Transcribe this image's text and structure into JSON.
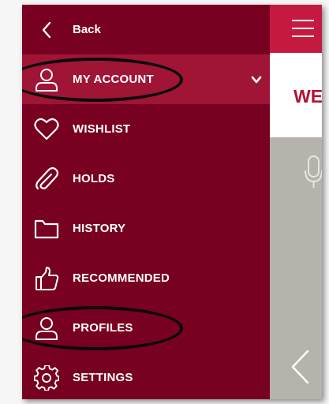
{
  "drawer": {
    "back_label": "Back",
    "items": [
      {
        "label": "MY ACCOUNT",
        "icon": "user-icon",
        "active": true,
        "expandable": true
      },
      {
        "label": "WISHLIST",
        "icon": "heart-icon"
      },
      {
        "label": "HOLDS",
        "icon": "paperclip-icon"
      },
      {
        "label": "HISTORY",
        "icon": "folder-icon"
      },
      {
        "label": "RECOMMENDED",
        "icon": "thumbs-up-icon"
      },
      {
        "label": "PROFILES",
        "icon": "user-icon"
      },
      {
        "label": "SETTINGS",
        "icon": "gear-icon"
      }
    ]
  },
  "main": {
    "welcome_text": "WE"
  },
  "colors": {
    "drawer_bg": "#780020",
    "active_item_bg": "#a01436",
    "topbar_bg": "#c41a40",
    "welcome_text": "#b31237",
    "content_bg": "#b5b3ac"
  }
}
